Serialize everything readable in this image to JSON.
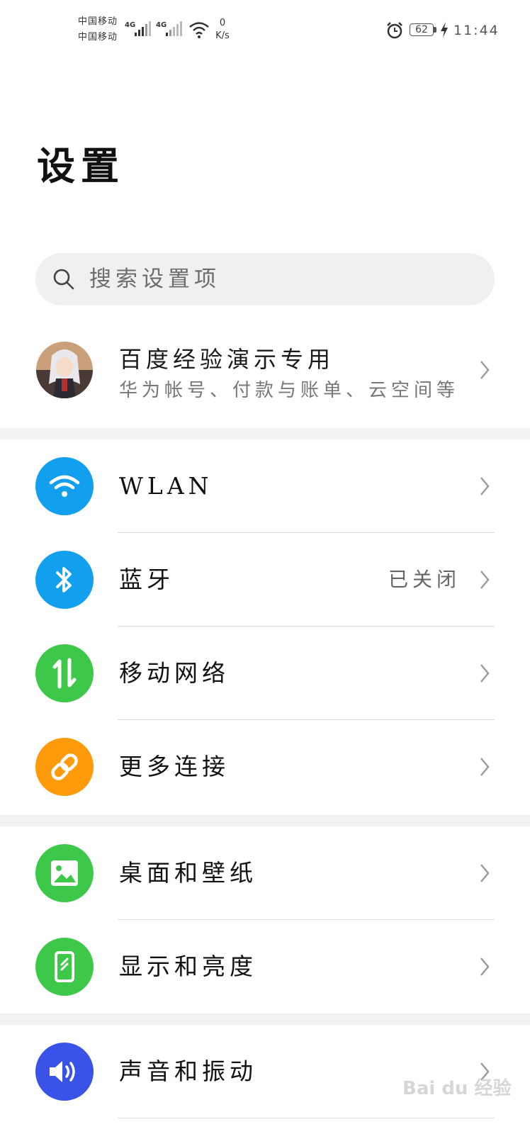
{
  "status_bar": {
    "carrier_1": "中国移动",
    "carrier_2": "中国移动",
    "net_speed_value": "0",
    "net_speed_unit": "K/s",
    "battery_level": "62",
    "time": "11:44"
  },
  "header": {
    "title": "设置"
  },
  "search": {
    "placeholder": "搜索设置项"
  },
  "account": {
    "name": "百度经验演示专用",
    "subtitle": "华为帐号、付款与账单、云空间等"
  },
  "settings_items": [
    {
      "label": "WLAN",
      "value": "",
      "icon": "wifi-icon",
      "color": "#12a0ee"
    },
    {
      "label": "蓝牙",
      "value": "已关闭",
      "icon": "bluetooth-icon",
      "color": "#12a0ee"
    },
    {
      "label": "移动网络",
      "value": "",
      "icon": "mobile-data-icon",
      "color": "#3ec84a"
    },
    {
      "label": "更多连接",
      "value": "",
      "icon": "link-icon",
      "color": "#ff9a0a"
    },
    {
      "label": "桌面和壁纸",
      "value": "",
      "icon": "image-icon",
      "color": "#3ec84a"
    },
    {
      "label": "显示和亮度",
      "value": "",
      "icon": "phone-display-icon",
      "color": "#3ec84a"
    },
    {
      "label": "声音和振动",
      "value": "",
      "icon": "speaker-icon",
      "color": "#3a52e8"
    }
  ],
  "watermark": "Bai du 经验"
}
